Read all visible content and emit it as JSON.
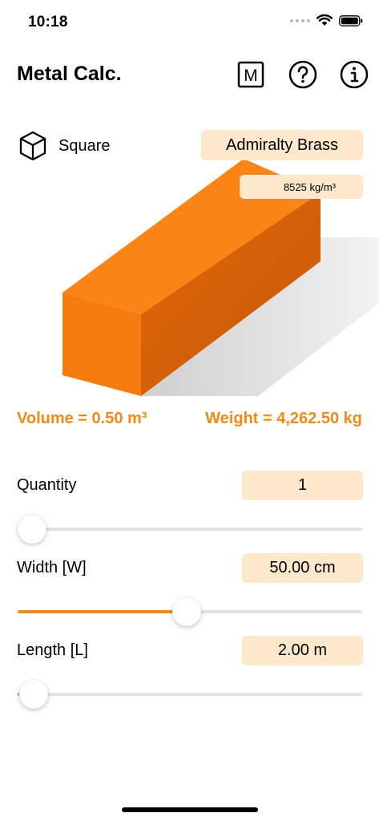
{
  "status": {
    "time": "10:18"
  },
  "header": {
    "title": "Metal Calc.",
    "units_button_label": "M",
    "help_icon": "question-circle-icon",
    "info_icon": "info-circle-icon"
  },
  "shape": {
    "icon": "cube-icon",
    "label": "Square"
  },
  "material": {
    "name": "Admiralty Brass",
    "density": "8525 kg/m³"
  },
  "results": {
    "volume": "Volume = 0.50 m³",
    "weight": "Weight = 4,262.50 kg"
  },
  "params": [
    {
      "label": "Quantity",
      "value": "1",
      "slider_fraction": 0.0
    },
    {
      "label": "Width [W]",
      "value": "50.00 cm",
      "slider_fraction": 0.49
    },
    {
      "label": "Length [L]",
      "value": "2.00 m",
      "slider_fraction": 0.005
    }
  ],
  "colors": {
    "accent": "#ef8a1c",
    "chip_background": "#fde8cc",
    "block_front": "#f57a10",
    "block_top": "#fb8416",
    "block_side": "#d86208"
  }
}
